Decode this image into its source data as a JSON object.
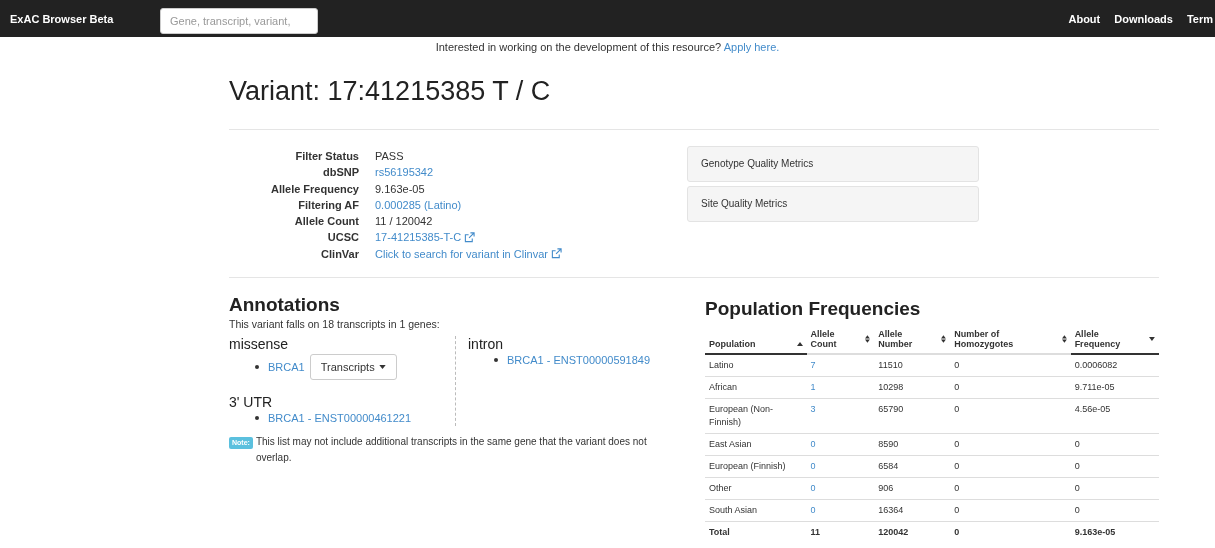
{
  "navbar": {
    "brand": "ExAC Browser Beta",
    "search": {
      "placeholder": "Gene, transcript, variant,"
    },
    "links": [
      "About",
      "Downloads",
      "Term"
    ]
  },
  "banner": {
    "text": "Interested in working on the development of this resource?",
    "link": "Apply here."
  },
  "title": "Variant: 17:41215385 T / C",
  "details": [
    {
      "label": "Filter Status",
      "value": "PASS",
      "kind": "text"
    },
    {
      "label": "dbSNP",
      "value": "rs56195342",
      "kind": "link"
    },
    {
      "label": "Allele Frequency",
      "value": "9.163e-05",
      "kind": "text"
    },
    {
      "label": "Filtering AF",
      "value": "0.000285 (Latino)",
      "kind": "link"
    },
    {
      "label": "Allele Count",
      "value": "11 / 120042",
      "kind": "text"
    },
    {
      "label": "UCSC",
      "value": "17-41215385-T-C",
      "kind": "external"
    },
    {
      "label": "ClinVar",
      "value": "Click to search for variant in Clinvar",
      "kind": "external"
    }
  ],
  "panels": [
    "Genotype Quality Metrics",
    "Site Quality Metrics"
  ],
  "annotations": {
    "heading": "Annotations",
    "summary": "This variant falls on 18 transcripts in 1 genes:",
    "left": [
      {
        "consequence": "missense",
        "items": [
          {
            "text": "BRCA1",
            "dropdown": "Transcripts"
          }
        ]
      },
      {
        "consequence": "3' UTR",
        "items": [
          {
            "text": "BRCA1 - ENST00000461221"
          }
        ]
      }
    ],
    "right": [
      {
        "consequence": "intron",
        "items": [
          {
            "text": "BRCA1 - ENST00000591849"
          }
        ]
      }
    ],
    "note_label": "Note:",
    "note": "This list may not include additional transcripts in the same gene that the variant does not overlap."
  },
  "population": {
    "heading": "Population Frequencies",
    "columns": [
      {
        "label": "Population",
        "kind": "ascending"
      },
      {
        "label": "Allele Count",
        "kind": "sortable"
      },
      {
        "label": "Allele Number",
        "kind": "sortable"
      },
      {
        "label": "Number of Homozygotes",
        "kind": "sortable"
      },
      {
        "label": "Allele Frequency",
        "kind": "descending"
      }
    ],
    "rows": [
      [
        "Latino",
        "7",
        "11510",
        "0",
        "0.0006082"
      ],
      [
        "African",
        "1",
        "10298",
        "0",
        "9.711e-05"
      ],
      [
        "European (Non-Finnish)",
        "3",
        "65790",
        "0",
        "4.56e-05"
      ],
      [
        "East Asian",
        "0",
        "8590",
        "0",
        "0"
      ],
      [
        "European (Finnish)",
        "0",
        "6584",
        "0",
        "0"
      ],
      [
        "Other",
        "0",
        "906",
        "0",
        "0"
      ],
      [
        "South Asian",
        "0",
        "16364",
        "0",
        "0"
      ]
    ],
    "total": [
      "Total",
      "11",
      "120042",
      "0",
      "9.163e-05"
    ]
  }
}
